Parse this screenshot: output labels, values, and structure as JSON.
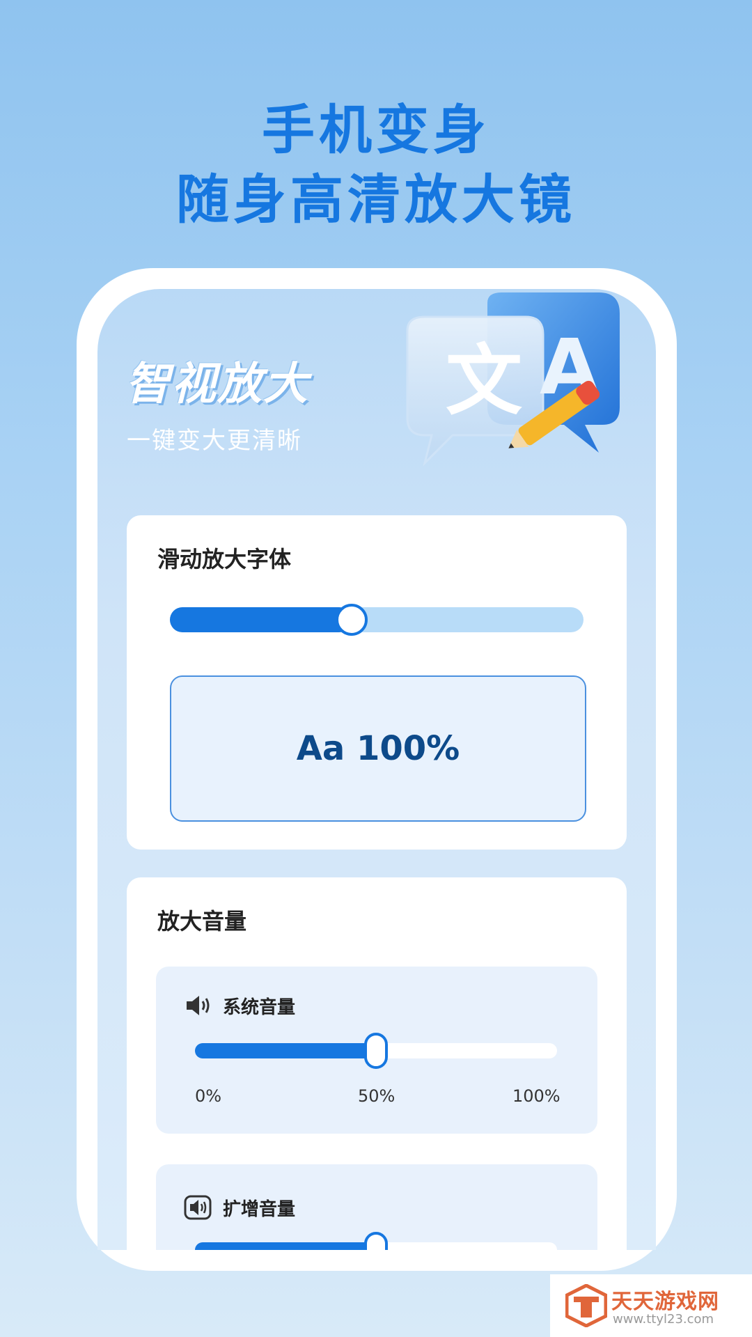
{
  "headline": {
    "line1": "手机变身",
    "line2": "随身高清放大镜"
  },
  "app": {
    "title": "智视放大",
    "subtitle": "一键变大更清晰"
  },
  "font_card": {
    "title": "滑动放大字体",
    "slider_level": 0.44,
    "preview_text": "Aa 100%"
  },
  "volume_card": {
    "title": "放大音量",
    "system_volume": {
      "label": "系统音量",
      "level": 0.5,
      "ticks": [
        "0%",
        "50%",
        "100%"
      ]
    },
    "boost_volume": {
      "label": "扩增音量",
      "level": 0.5
    }
  },
  "watermark": {
    "text": "天天游戏网",
    "url": "www.ttyl23.com"
  },
  "colors": {
    "accent": "#1677e0",
    "track": "#b8dcf8",
    "watermark": "#e0663a"
  }
}
